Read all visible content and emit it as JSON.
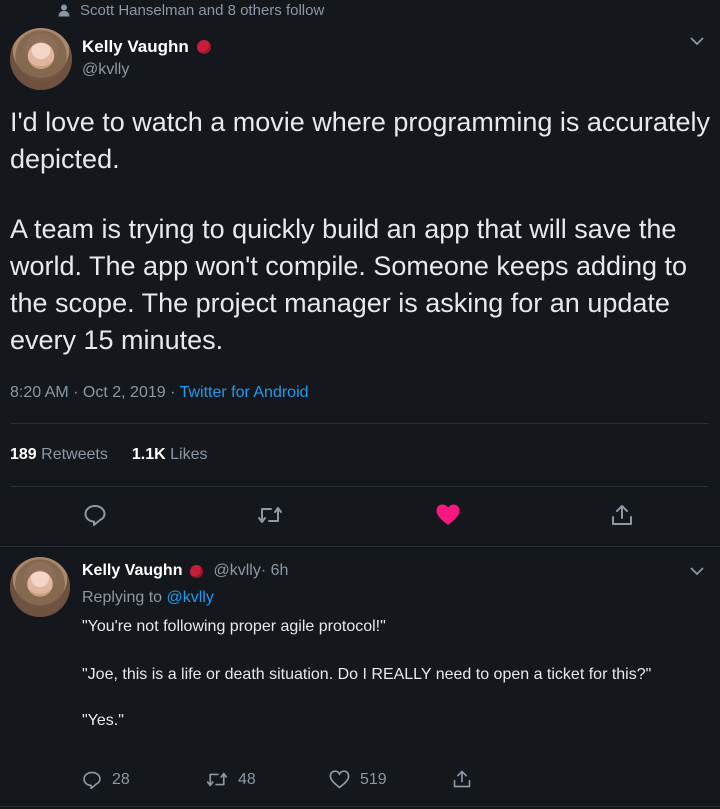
{
  "social_context": {
    "icon": "person-icon",
    "text": "Scott Hanselman and 8 others follow"
  },
  "tweet": {
    "author": {
      "name": "Kelly Vaughn",
      "handle": "@kvlly"
    },
    "paragraph_1": "I'd love to watch a movie where programming is accurately depicted.",
    "paragraph_2": "A team is trying to quickly build an app that will save the world. The app won't compile. Someone keeps adding to the scope. The project manager is asking for an update every 15 minutes.",
    "timestamp": "8:20 AM · Oct 2, 2019 · ",
    "source": "Twitter for Android",
    "stats": {
      "retweets_count": "189",
      "retweets_label": "Retweets",
      "likes_count": "1.1K",
      "likes_label": "Likes"
    },
    "actions": [
      "reply-icon",
      "retweet-icon",
      "heart-icon",
      "share-icon"
    ]
  },
  "reply": {
    "author": {
      "name": "Kelly Vaughn",
      "handle": "@kvlly",
      "time": " · 6h"
    },
    "replying_to_label": "Replying to ",
    "replying_to_handle": "@kvlly",
    "line_1": "\"You're not following proper agile protocol!\"",
    "line_2": "\"Joe, this is a life or death situation. Do I REALLY need to open a ticket for this?\"",
    "line_3": "\"Yes.\"",
    "counts": {
      "replies": "28",
      "retweets": "48",
      "likes": "519"
    }
  },
  "colors": {
    "background": "#14171c",
    "link": "#1d9bf0",
    "like_active": "#f91880",
    "verified_badge": "#c81e3b",
    "muted_text": "#8b98a5"
  }
}
